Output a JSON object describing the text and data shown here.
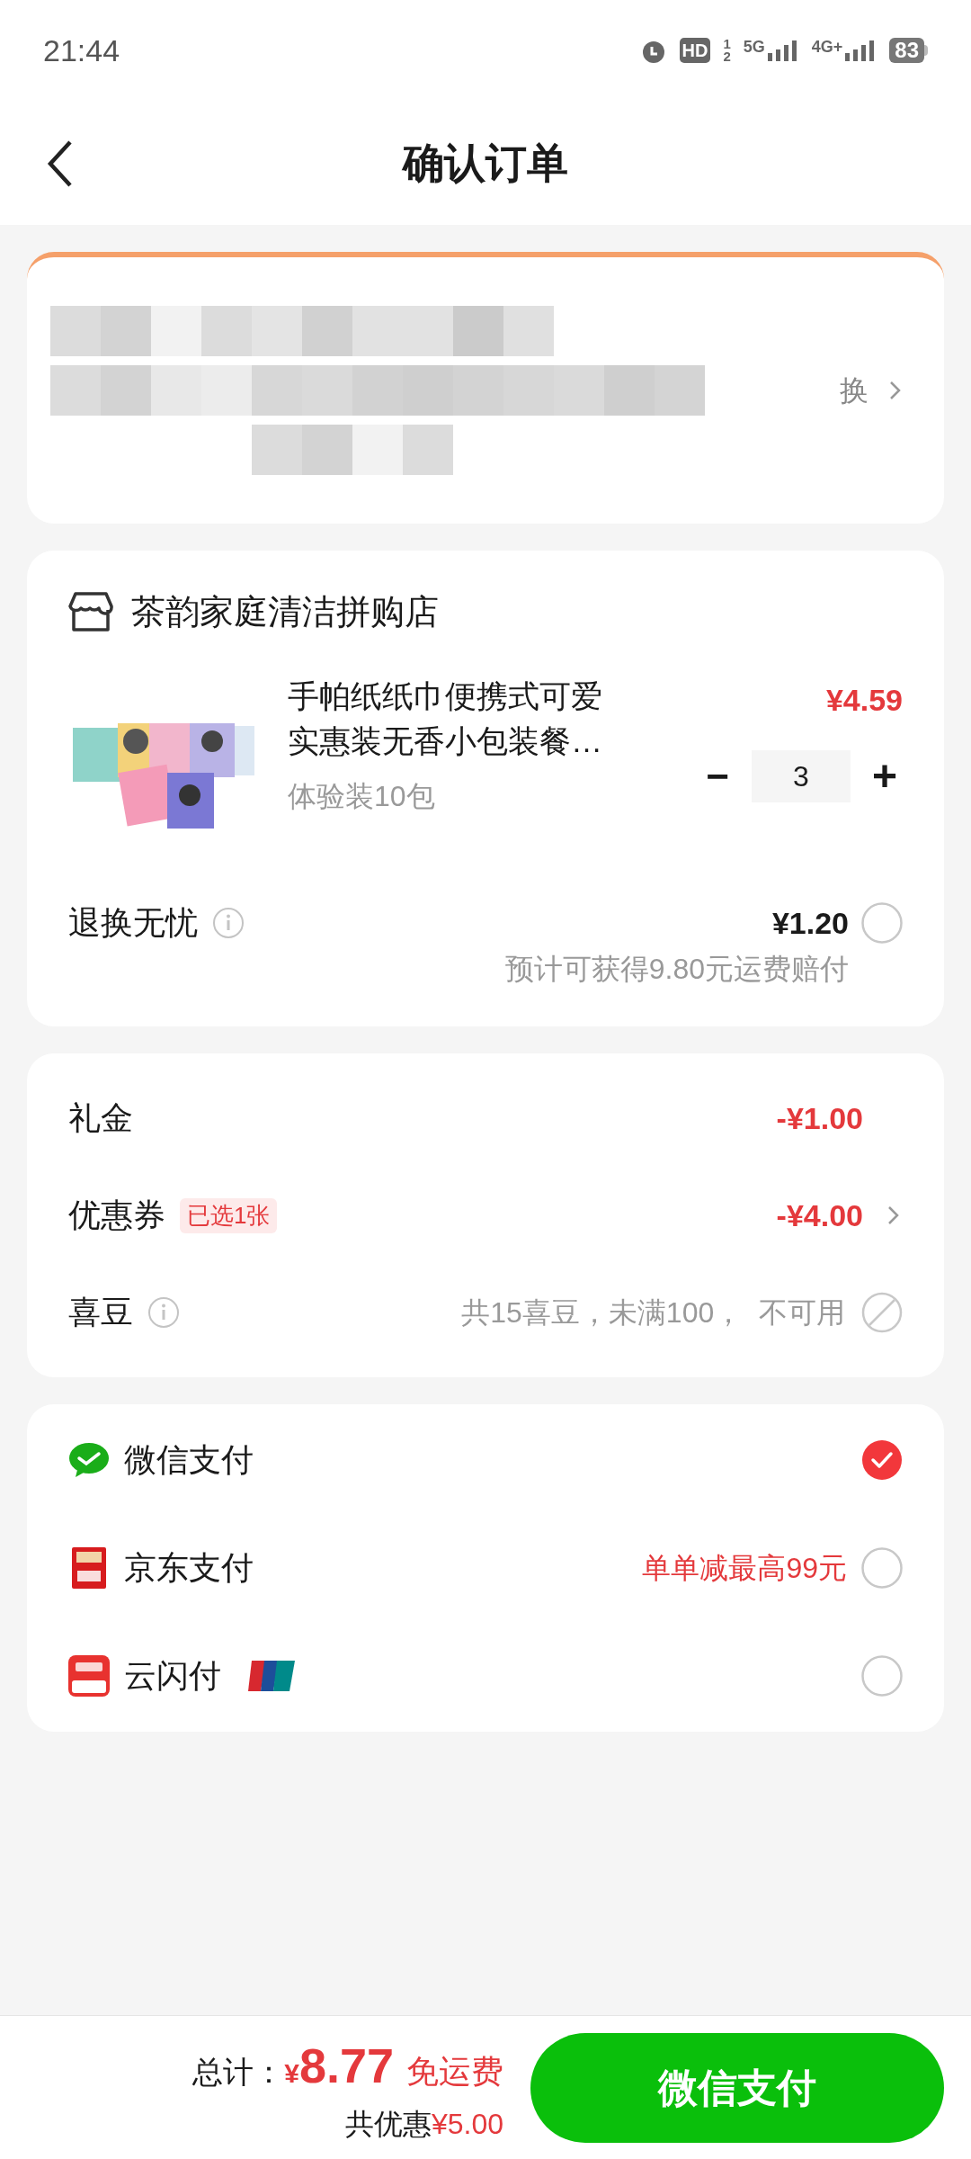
{
  "status_bar": {
    "time": "21:44",
    "hd": "HD",
    "hd_sim": "1",
    "hd_sim2": "2",
    "network_1": "5G",
    "network_2": "4G+",
    "battery": "83"
  },
  "header": {
    "title": "确认订单"
  },
  "address": {
    "switch_label": "换"
  },
  "store": {
    "name": "茶韵家庭清洁拼购店",
    "product": {
      "title": "手帕纸纸巾便携式可爱实惠装无香小包装餐…",
      "spec": "体验装10包",
      "price": "¥4.59",
      "quantity": "3",
      "minus": "−",
      "plus": "+"
    },
    "insurance": {
      "label": "退换无忧",
      "price": "¥1.20",
      "note": "预计可获得9.80元运费赔付",
      "selected": false
    }
  },
  "discounts": [
    {
      "kind": "plain",
      "label": "礼金",
      "value": "-¥1.00"
    },
    {
      "kind": "coupon",
      "label": "优惠券",
      "tag": "已选1张",
      "value": "-¥4.00"
    },
    {
      "kind": "beans",
      "label": "喜豆",
      "value": "共15喜豆，未满100，  不可用"
    }
  ],
  "payments": [
    {
      "kind": "wechat",
      "label": "微信支付",
      "selected": true
    },
    {
      "kind": "jd",
      "label": "京东支付",
      "promo": "单单减最高99元",
      "selected": false
    },
    {
      "kind": "unionpay",
      "label": "云闪付",
      "selected": false
    }
  ],
  "footer": {
    "total_label": "总计：",
    "currency": "¥",
    "total": "8.77",
    "shipping": "免运费",
    "saving_label": "共优惠",
    "saving": "¥5.00",
    "pay_button": "微信支付"
  }
}
